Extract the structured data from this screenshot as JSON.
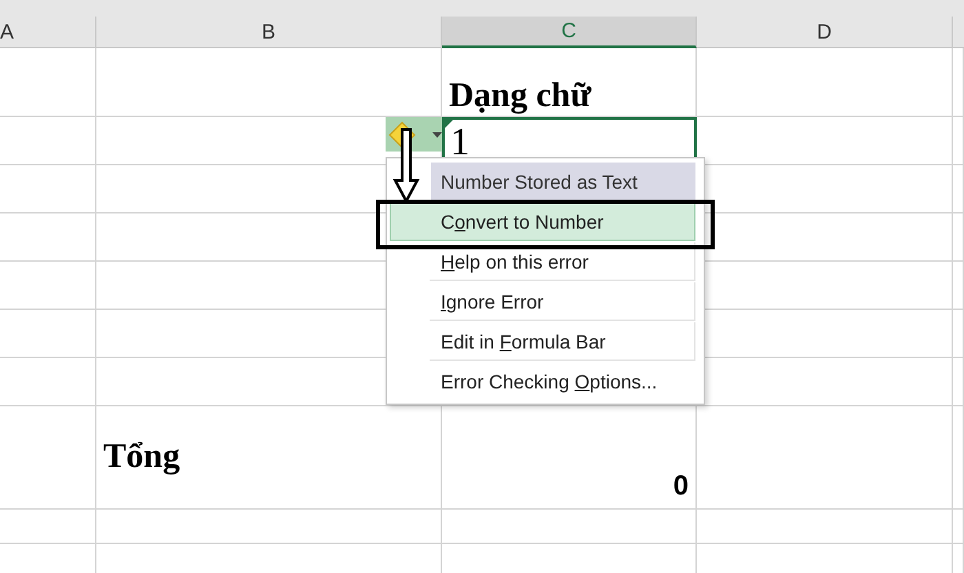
{
  "columns": [
    {
      "label": "A",
      "selected": false
    },
    {
      "label": "B",
      "selected": false
    },
    {
      "label": "C",
      "selected": true
    },
    {
      "label": "D",
      "selected": false
    }
  ],
  "heading_cell": {
    "text": "Dạng chữ"
  },
  "value_cell": {
    "text": "1",
    "selected": true,
    "error_flag": true
  },
  "total_label": {
    "text": "Tổng"
  },
  "total_value": {
    "text": "0"
  },
  "error_menu": {
    "title": "Number Stored as Text",
    "items": [
      {
        "before": "C",
        "key": "o",
        "after": "nvert to Number",
        "selected": true
      },
      {
        "key": "H",
        "after": "elp on this error",
        "selected": false
      },
      {
        "key": "I",
        "after": "gnore Error",
        "selected": false
      },
      {
        "before": "Edit in ",
        "key": "F",
        "after": "ormula Bar",
        "selected": false
      },
      {
        "before": "Error Checking ",
        "key": "O",
        "after": "ptions...",
        "selected": false
      }
    ]
  }
}
